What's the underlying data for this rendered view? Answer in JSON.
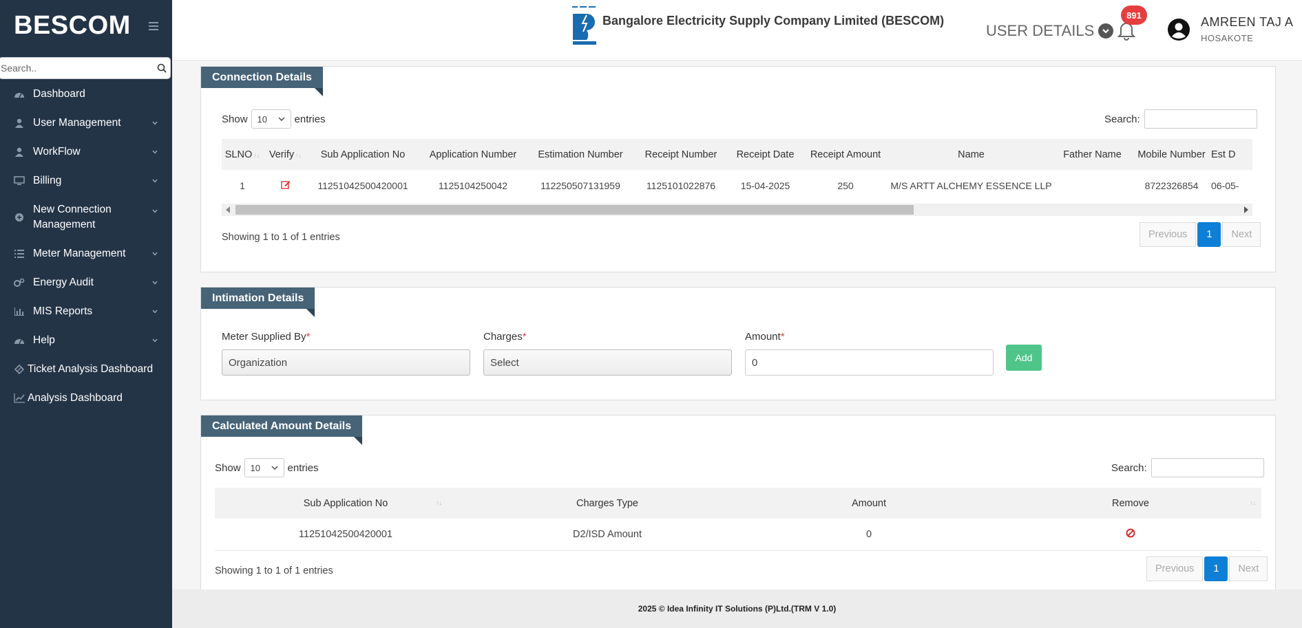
{
  "sidebar": {
    "brand": "BESCOM",
    "search_placeholder": "Search..",
    "items": [
      {
        "label": "Dashboard",
        "icon": "dashboard-icon"
      },
      {
        "label": "User Management",
        "icon": "user-icon"
      },
      {
        "label": "WorkFlow",
        "icon": "user-icon"
      },
      {
        "label": "Billing",
        "icon": "monitor-icon"
      },
      {
        "label": "New Connection Management",
        "icon": "plus-circle-icon"
      },
      {
        "label": "Meter Management",
        "icon": "list-icon"
      },
      {
        "label": "Energy Audit",
        "icon": "gears-icon"
      },
      {
        "label": "MIS Reports",
        "icon": "bar-chart-icon"
      },
      {
        "label": "Help",
        "icon": "dashboard-icon"
      },
      {
        "label": "Ticket Analysis Dashboard",
        "icon": "diamond-icon"
      },
      {
        "label": "Analysis Dashboard",
        "icon": "line-chart-icon"
      }
    ]
  },
  "header": {
    "company": "Bangalore Electricity Supply Company Limited (BESCOM)",
    "user_details": "USER DETAILS",
    "notifications": "891",
    "user_name": "AMREEN TAJ A",
    "user_location": "HOSAKOTE"
  },
  "connection": {
    "title": "Connection Details",
    "show": "Show",
    "entries_value": "10",
    "entries": "entries",
    "search_label": "Search:",
    "columns": [
      "SLNO",
      "Verify",
      "Sub Application No",
      "Application Number",
      "Estimation Number",
      "Receipt Number",
      "Receipt Date",
      "Receipt Amount",
      "Name",
      "Father Name",
      "Mobile Number",
      "Est D"
    ],
    "row": {
      "slno": "1",
      "sub_app": "11251042500420001",
      "app_no": "1125104250042",
      "est_no": "112250507131959",
      "receipt_no": "1125101022876",
      "receipt_date": "15-04-2025",
      "receipt_amount": "250",
      "name": "M/S ARTT ALCHEMY ESSENCE LLP",
      "father": "",
      "mobile": "8722326854",
      "est_d": "06-05-"
    },
    "info": "Showing 1 to 1 of 1 entries",
    "prev": "Previous",
    "page": "1",
    "next": "Next"
  },
  "intimation": {
    "title": "Intimation Details",
    "meter_label": "Meter Supplied By",
    "meter_value": "Organization",
    "charges_label": "Charges",
    "charges_value": "Select",
    "amount_label": "Amount",
    "amount_value": "0",
    "required": "*",
    "add": "Add"
  },
  "calculated": {
    "title": "Calculated Amount Details",
    "show": "Show",
    "entries_value": "10",
    "entries": "entries",
    "search_label": "Search:",
    "columns": [
      "Sub Application No",
      "Charges Type",
      "Amount",
      "Remove"
    ],
    "row": {
      "sub_app": "11251042500420001",
      "charges_type": "D2/ISD Amount",
      "amount": "0"
    },
    "info": "Showing 1 to 1 of 1 entries",
    "prev": "Previous",
    "page": "1",
    "next": "Next"
  },
  "footer": "2025 © Idea Infinity IT Solutions (P)Ltd.(TRM V 1.0)",
  "colors": {
    "sidebar": "#243447",
    "panel_tag": "#466378",
    "accent": "#0d7fd6",
    "add": "#4fc58a",
    "badge": "#e53e3e"
  }
}
